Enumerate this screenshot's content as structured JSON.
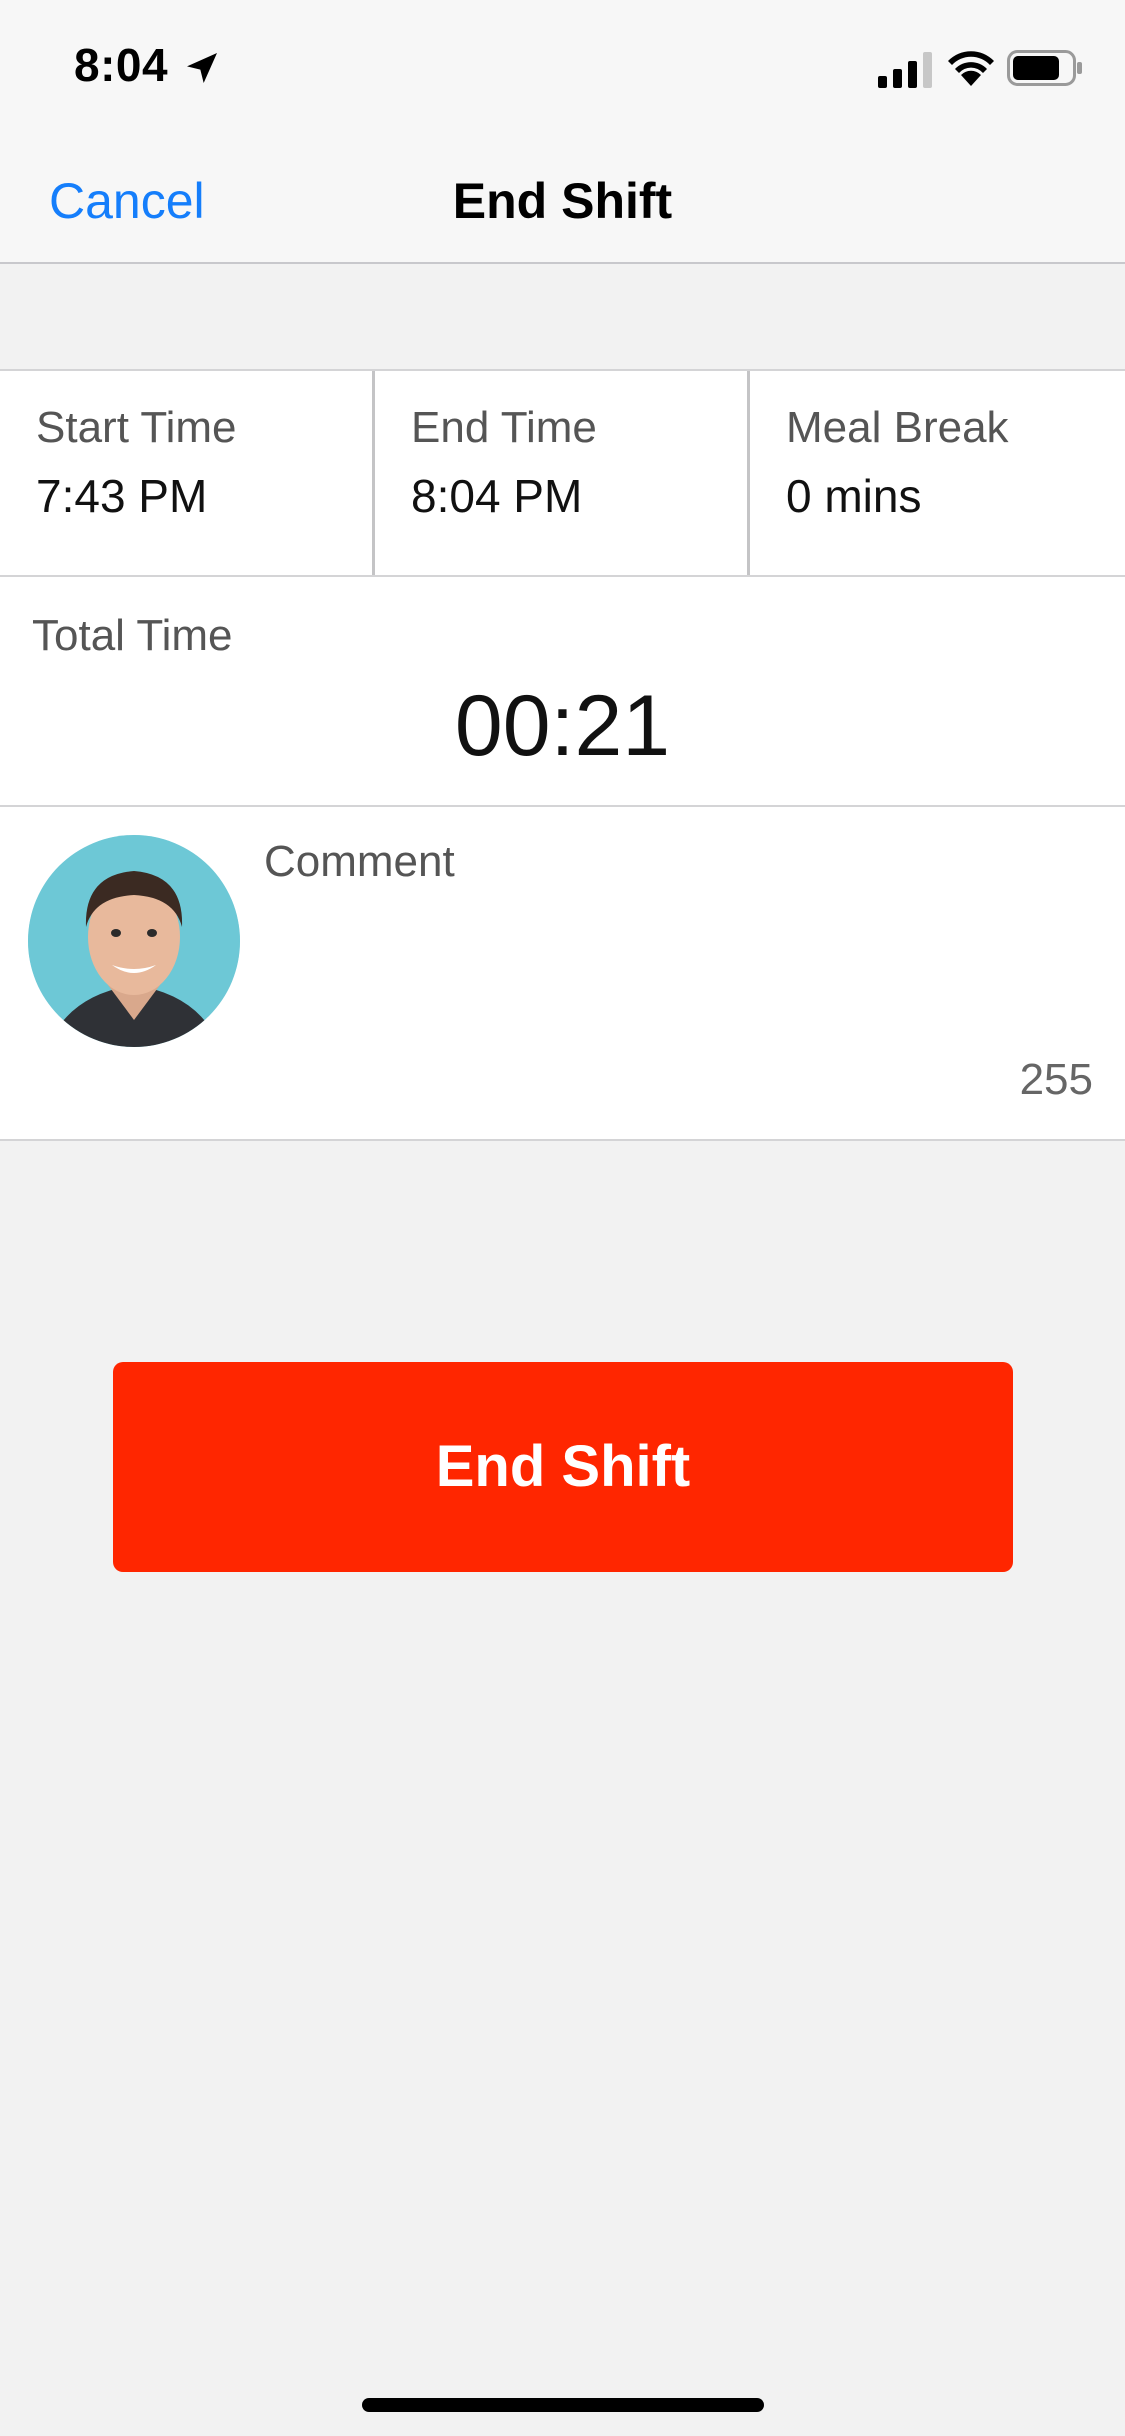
{
  "status_bar": {
    "time": "8:04",
    "icons": [
      "location-arrow-icon",
      "signal-icon",
      "wifi-icon",
      "battery-icon"
    ]
  },
  "nav": {
    "cancel_label": "Cancel",
    "title": "End Shift"
  },
  "times": {
    "start": {
      "label": "Start Time",
      "value": "7:43 PM"
    },
    "end": {
      "label": "End Time",
      "value": "8:04 PM"
    },
    "meal_break": {
      "label": "Meal Break",
      "value": "0 mins"
    }
  },
  "total": {
    "label": "Total Time",
    "value": "00:21"
  },
  "comment": {
    "placeholder": "Comment",
    "value": "",
    "char_remaining": "255"
  },
  "action": {
    "end_shift_label": "End Shift"
  },
  "colors": {
    "accent_blue": "#157efb",
    "button_red": "#ff2600",
    "background": "#f2f2f2"
  }
}
